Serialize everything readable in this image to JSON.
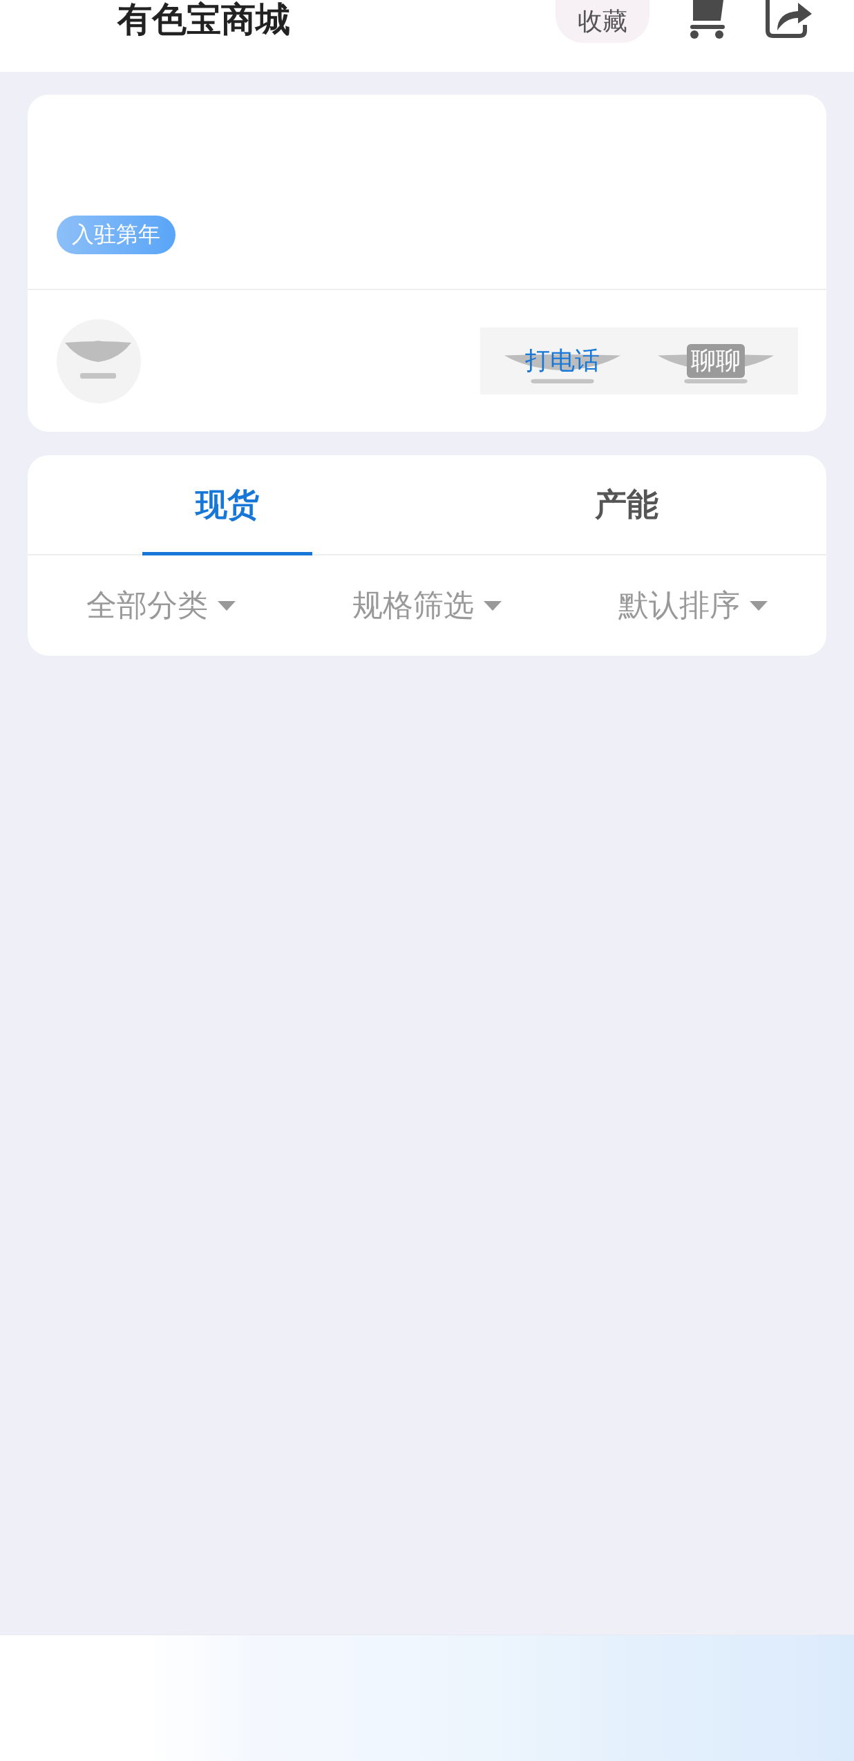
{
  "header": {
    "title": "有色宝商城",
    "collect_button": "收藏"
  },
  "shop_card": {
    "badge": "入驻第年",
    "actions": [
      {
        "kind": "call",
        "label": "打电话"
      },
      {
        "kind": "chat",
        "label": "聊聊"
      }
    ]
  },
  "tabs": [
    {
      "label": "现货",
      "selected": true
    },
    {
      "label": "产能",
      "selected": false
    }
  ],
  "filters": [
    {
      "label": "全部分类"
    },
    {
      "label": "规格筛选"
    },
    {
      "label": "默认排序"
    }
  ]
}
